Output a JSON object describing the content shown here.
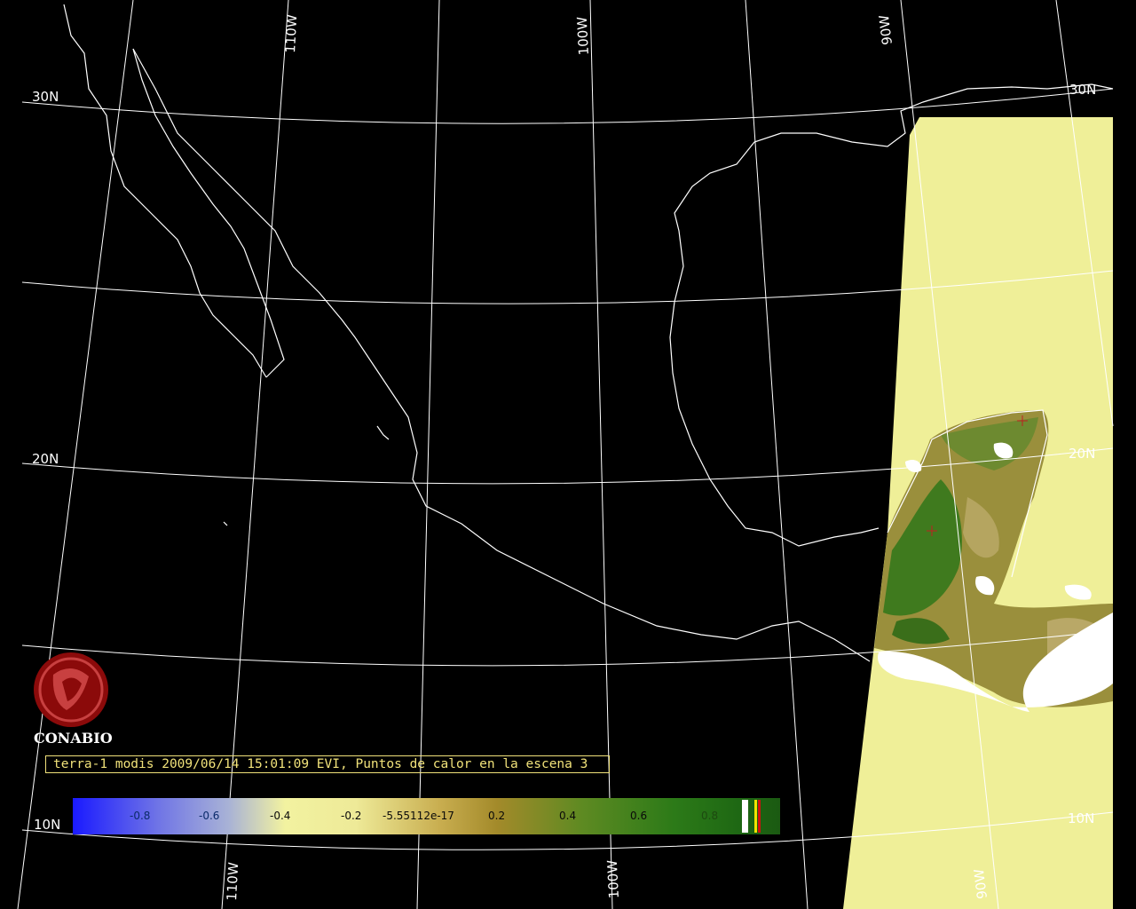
{
  "map": {
    "lat_labels": [
      "30N",
      "20N",
      "10N"
    ],
    "lon_labels": [
      "110W",
      "100W",
      "90W"
    ],
    "colors": {
      "background": "#000000",
      "grid": "#ffffff",
      "coastline": "#ffffff",
      "no_data_swath": "#efef98",
      "caption": "#f1e27a",
      "logo": "#8b0a0a"
    }
  },
  "logo": {
    "text": "CONABIO"
  },
  "caption": {
    "text": "terra-1 modis 2009/06/14 15:01:09 EVI, Puntos de calor en la escena 3"
  },
  "colorbar": {
    "ticks": [
      "-0.8",
      "-0.6",
      "-0.4",
      "-0.2",
      "-5.55112e-17",
      "0.2",
      "0.4",
      "0.6",
      "0.8"
    ]
  }
}
